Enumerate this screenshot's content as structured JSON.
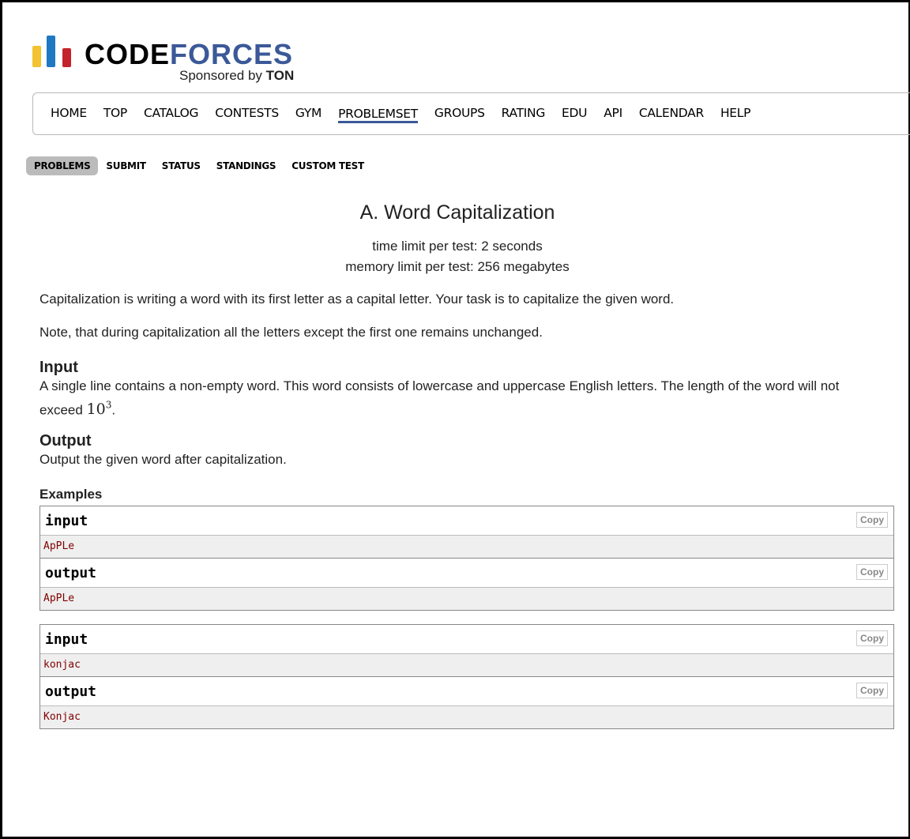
{
  "logo": {
    "code": "CODE",
    "forces": "FORCES",
    "sponsored_by": "Sponsored by",
    "sponsor": "TON"
  },
  "menu": {
    "items": [
      "HOME",
      "TOP",
      "CATALOG",
      "CONTESTS",
      "GYM",
      "PROBLEMSET",
      "GROUPS",
      "RATING",
      "EDU",
      "API",
      "CALENDAR",
      "HELP"
    ],
    "active": "PROBLEMSET"
  },
  "submenu": {
    "items": [
      "PROBLEMS",
      "SUBMIT",
      "STATUS",
      "STANDINGS",
      "CUSTOM TEST"
    ],
    "active": "PROBLEMS"
  },
  "problem": {
    "title": "A. Word Capitalization",
    "time_limit": "time limit per test: 2 seconds",
    "memory_limit": "memory limit per test: 256 megabytes",
    "statement_1": "Capitalization is writing a word with its first letter as a capital letter. Your task is to capitalize the given word.",
    "statement_2": "Note, that during capitalization all the letters except the first one remains unchanged.",
    "input_title": "Input",
    "input_text_1": "A single line contains a non-empty word. This word consists of lowercase and uppercase English letters. The length of the word will not exceed ",
    "input_math_base": "10",
    "input_math_exp": "3",
    "input_text_2": ".",
    "output_title": "Output",
    "output_text": "Output the given word after capitalization.",
    "examples_title": "Examples"
  },
  "examples": [
    {
      "input_label": "input",
      "input": "ApPLe",
      "output_label": "output",
      "output": "ApPLe",
      "copy": "Copy"
    },
    {
      "input_label": "input",
      "input": "konjac",
      "output_label": "output",
      "output": "Konjac",
      "copy": "Copy"
    }
  ]
}
